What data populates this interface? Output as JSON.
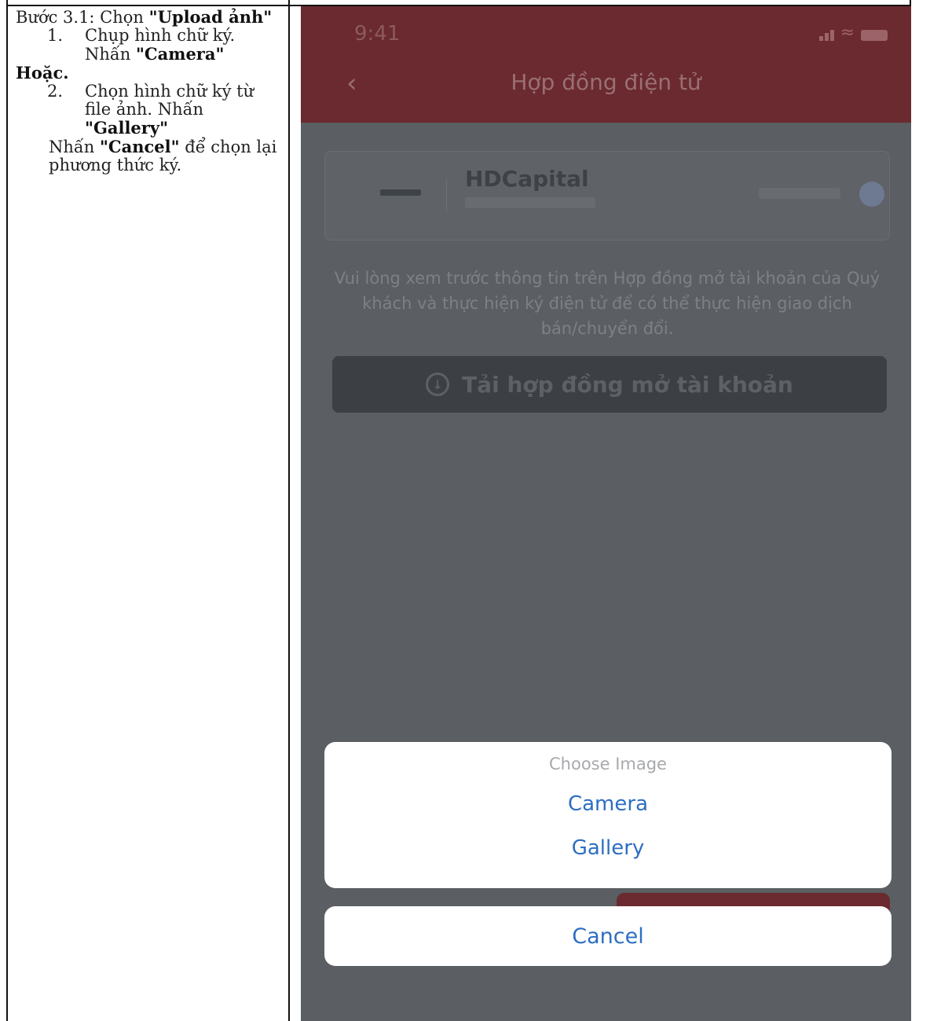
{
  "instructions": {
    "step_prefix": "Bước 3.1: Chọn ",
    "step_bold": "\"Upload ảnh\"",
    "item1_num": "1.",
    "item1_text": "Chụp hình chữ ký. Nhấn ",
    "item1_bold": "\"Camera\"",
    "or_text": "Hoặc.",
    "item2_num": "2.",
    "item2_text": "Chọn hình chữ ký từ file ảnh. Nhấn ",
    "item2_bold": "\"Gallery\"",
    "note_prefix": "Nhấn ",
    "note_bold": "\"Cancel\"",
    "note_suffix": " để chọn lại phương thức ký."
  },
  "phone": {
    "status_time": "9:41",
    "back_icon": "chevron-left-icon",
    "title": "Hợp đồng điện tử",
    "card_name": "HDCapital",
    "description": "Vui lòng xem trước thông tin trên Hợp đồng mở tài khoản của Quý khách và thực hiện ký điện tử để có thể thực hiện giao dịch bán/chuyển đổi.",
    "download_button": "Tải hợp đồng mở tài khoản",
    "download_icon": "download-icon",
    "action_sheet": {
      "title": "Choose Image",
      "options": [
        "Camera",
        "Gallery"
      ],
      "cancel": "Cancel"
    }
  },
  "colors": {
    "appbar": "#6a2a2f",
    "overlay": "#5b5e62",
    "action_blue": "#2d6ec2"
  }
}
